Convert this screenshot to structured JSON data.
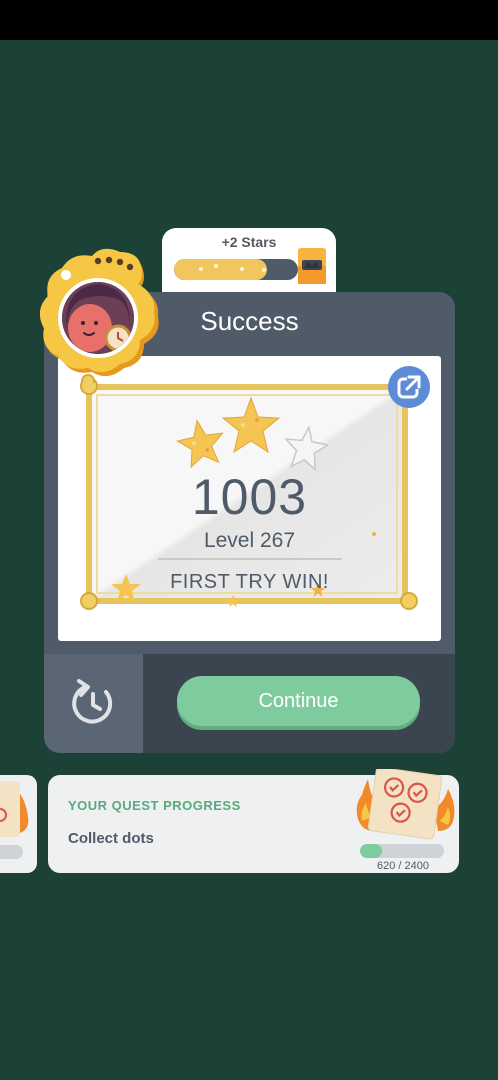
{
  "reward": {
    "label": "+2 Stars",
    "progress": 0.75
  },
  "result": {
    "title": "Success",
    "score": "1003",
    "level": "Level 267",
    "subtitle": "FIRST TRY WIN!",
    "stars_earned": 2,
    "stars_total": 3
  },
  "actions": {
    "continue_label": "Continue"
  },
  "quest": {
    "title": "YOUR QUEST PROGRESS",
    "task": "Collect dots",
    "count": "620 / 2400",
    "current": 620,
    "target": 2400
  },
  "colors": {
    "background": "#1c4238",
    "card": "#4f5b68",
    "accent_green": "#7ecb9d",
    "gold": "#e7c35c",
    "share_blue": "#5d8bd7"
  }
}
